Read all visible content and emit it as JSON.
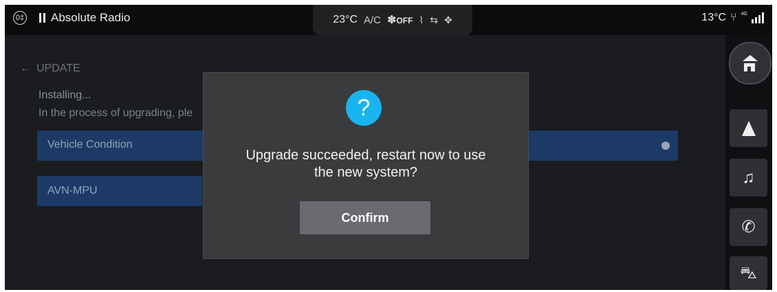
{
  "status_bar": {
    "fog_icon_glyph": "0‡",
    "media_title": "Absolute Radio",
    "climate": {
      "temperature": "23°C",
      "ac_label": "A/C",
      "fan_glyph": "✽",
      "fan_status": "OFF",
      "defrost_glyph": "⌇",
      "recirc_glyph": "⇆",
      "seat_glyph": "✥"
    },
    "outside_temperature": "13°C",
    "network_label": "4G",
    "usb_glyph": "⑂"
  },
  "page": {
    "back_glyph": "←",
    "title": "UPDATE",
    "installing_text": "Installing...",
    "process_text": "In the process of upgrading, ple",
    "items": [
      {
        "label": "Vehicle Condition"
      },
      {
        "label": "AVN-MPU"
      }
    ]
  },
  "dock": {
    "items": [
      {
        "name": "home",
        "glyph": ""
      },
      {
        "name": "navigation",
        "glyph": ""
      },
      {
        "name": "music",
        "glyph": "♫"
      },
      {
        "name": "phone",
        "glyph": "✆"
      },
      {
        "name": "vehicle",
        "glyph": "⛍"
      }
    ]
  },
  "dialog": {
    "icon_glyph": "?",
    "message_line1": "Upgrade succeeded, restart now to use",
    "message_line2": "the new system?",
    "confirm_label": "Confirm"
  },
  "colors": {
    "accent_blue": "#19b4ee",
    "list_item_bg": "#1d3a66",
    "dialog_bg": "#3a3b3d"
  }
}
